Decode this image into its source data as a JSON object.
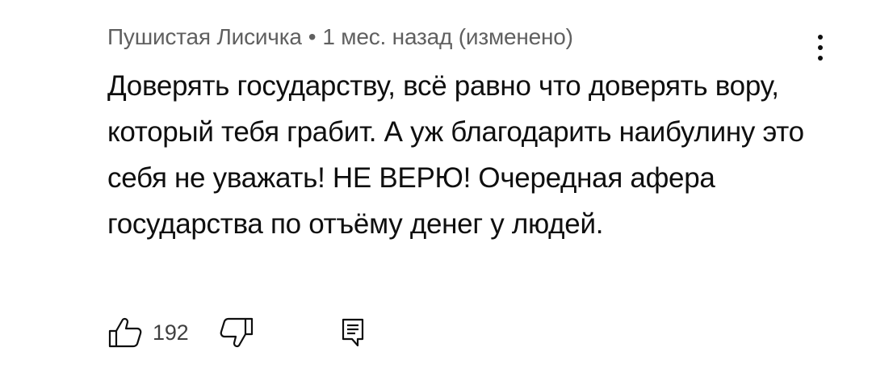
{
  "comment": {
    "author": "Пушистая Лисичка",
    "separator": "•",
    "time": "1 мес. назад",
    "edited": "(изменено)",
    "text": "Доверять государству, всё равно что доверять вору, который тебя грабит. А уж благодарить наибулину это себя не уважать! НЕ ВЕРЮ! Очередная афера государства по отъёму денег у людей.",
    "like_count": "192"
  },
  "icons": {
    "like": "thumb-up-icon",
    "dislike": "thumb-down-icon",
    "reply": "reply-comment-icon",
    "more": "more-vertical-icon"
  },
  "colors": {
    "text": "#0f0f0f",
    "secondary": "#606060",
    "background": "#ffffff"
  }
}
